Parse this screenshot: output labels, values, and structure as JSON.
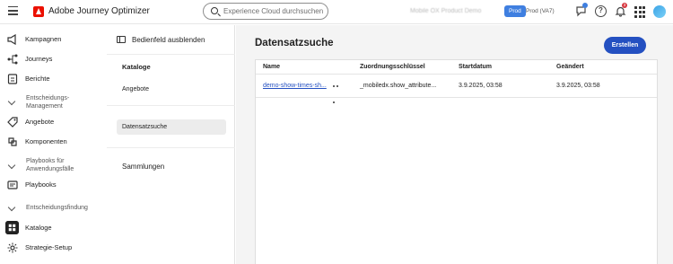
{
  "topbar": {
    "app_title": "Adobe Journey Optimizer",
    "search_placeholder": "Experience Cloud durchsuchen Ctr...",
    "org_name": "Mobile OX Product Demo",
    "sandbox_badge": "Prod",
    "sandbox_name": "Prod (VA7)",
    "notification_count": "3",
    "help_glyph": "?",
    "colors": {
      "brand": "#eb1000",
      "sandbox": "#3f7fe0",
      "notification": "#d7373f"
    }
  },
  "leftnav": {
    "items": [
      {
        "label": "Kampagnen",
        "icon": "campaigns-icon"
      },
      {
        "label": "Journeys",
        "icon": "journeys-icon"
      },
      {
        "label": "Berichte",
        "icon": "reports-icon"
      },
      {
        "section": "Entscheidungs-\nManagement"
      },
      {
        "label": "Angebote",
        "icon": "offers-icon"
      },
      {
        "label": "Komponenten",
        "icon": "components-icon"
      },
      {
        "section": "Playbooks für\nAnwendungsfälle"
      },
      {
        "label": "Playbooks",
        "icon": "playbooks-icon"
      },
      {
        "section": "Entscheidungsfindung"
      },
      {
        "label": "Kataloge",
        "icon": "catalogs-icon",
        "selected": true
      },
      {
        "label": "Strategie-Setup",
        "icon": "strategy-setup-icon"
      }
    ],
    "section_1": "Entscheidungs-\nManagement",
    "section_2": "Playbooks für\nAnwendungsfälle",
    "section_3": "Entscheidungsfindung"
  },
  "subnav": {
    "toggle_label": "Bedienfeld ausblenden",
    "catalogs_heading": "Kataloge",
    "offers_item": "Angebote",
    "dataset_search_item": "Datensatzsuche",
    "collections_heading": "Sammlungen"
  },
  "main": {
    "title": "Datensatzsuche",
    "create_button": "Erstellen",
    "columns": [
      "Name",
      "Zuordnungsschlüssel",
      "Startdatum",
      "Geändert"
    ],
    "rows": [
      {
        "name": "demo-show-times-sh...",
        "key": "_mobiledx.show_attribute...",
        "start_date": "3.9.2025, 03:58",
        "modified": "3.9.2025, 03:58"
      }
    ],
    "colors": {
      "accent": "#2450c1"
    }
  }
}
